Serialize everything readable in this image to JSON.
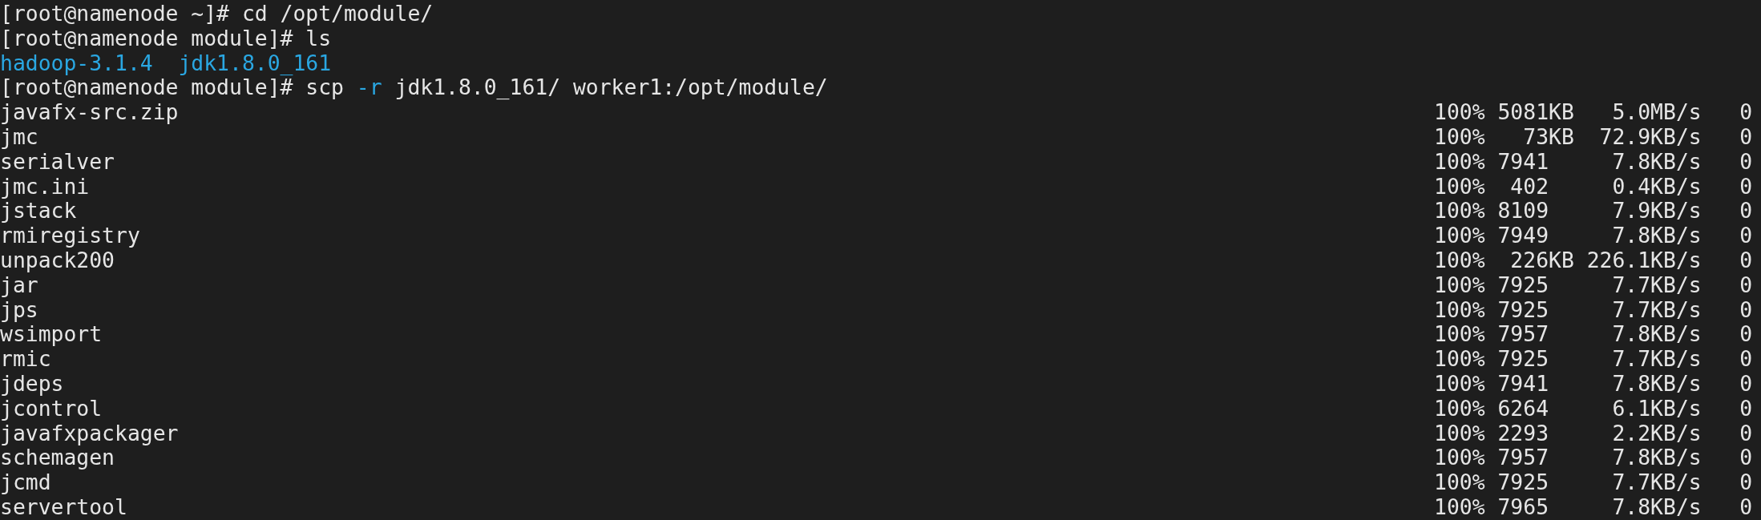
{
  "terminal": {
    "lines": [
      {
        "kind": "prompt",
        "prompt": "[root@namenode ~]#",
        "parts": [
          {
            "text": "cd /opt/module/",
            "kind": "plain"
          }
        ]
      },
      {
        "kind": "prompt",
        "prompt": "[root@namenode module]#",
        "parts": [
          {
            "text": "ls",
            "kind": "plain"
          }
        ]
      },
      {
        "kind": "listing",
        "entries": [
          "hadoop-3.1.4",
          "jdk1.8.0_161"
        ]
      },
      {
        "kind": "prompt",
        "prompt": "[root@namenode module]#",
        "parts": [
          {
            "text": "scp",
            "kind": "plain"
          },
          {
            "text": "-r",
            "kind": "flag"
          },
          {
            "text": "jdk1.8.0_161/ worker1:/opt/module/",
            "kind": "plain"
          }
        ]
      },
      {
        "kind": "transfer",
        "file": "javafx-src.zip",
        "percent": "100%",
        "size": "5081KB",
        "rate": "5.0MB/s",
        "time": "0"
      },
      {
        "kind": "transfer",
        "file": "jmc",
        "percent": "100%",
        "size": "  73KB",
        "rate": "72.9KB/s",
        "time": "0"
      },
      {
        "kind": "transfer",
        "file": "serialver",
        "percent": "100%",
        "size": "7941",
        "rate": "7.8KB/s",
        "time": "0"
      },
      {
        "kind": "transfer",
        "file": "jmc.ini",
        "percent": "100%",
        "size": " 402",
        "rate": "0.4KB/s",
        "time": "0"
      },
      {
        "kind": "transfer",
        "file": "jstack",
        "percent": "100%",
        "size": "8109",
        "rate": "7.9KB/s",
        "time": "0"
      },
      {
        "kind": "transfer",
        "file": "rmiregistry",
        "percent": "100%",
        "size": "7949",
        "rate": "7.8KB/s",
        "time": "0"
      },
      {
        "kind": "transfer",
        "file": "unpack200",
        "percent": "100%",
        "size": " 226KB",
        "rate": "226.1KB/s",
        "time": "0"
      },
      {
        "kind": "transfer",
        "file": "jar",
        "percent": "100%",
        "size": "7925",
        "rate": "7.7KB/s",
        "time": "0"
      },
      {
        "kind": "transfer",
        "file": "jps",
        "percent": "100%",
        "size": "7925",
        "rate": "7.7KB/s",
        "time": "0"
      },
      {
        "kind": "transfer",
        "file": "wsimport",
        "percent": "100%",
        "size": "7957",
        "rate": "7.8KB/s",
        "time": "0"
      },
      {
        "kind": "transfer",
        "file": "rmic",
        "percent": "100%",
        "size": "7925",
        "rate": "7.7KB/s",
        "time": "0"
      },
      {
        "kind": "transfer",
        "file": "jdeps",
        "percent": "100%",
        "size": "7941",
        "rate": "7.8KB/s",
        "time": "0"
      },
      {
        "kind": "transfer",
        "file": "jcontrol",
        "percent": "100%",
        "size": "6264",
        "rate": "6.1KB/s",
        "time": "0"
      },
      {
        "kind": "transfer",
        "file": "javafxpackager",
        "percent": "100%",
        "size": "2293",
        "rate": "2.2KB/s",
        "time": "0"
      },
      {
        "kind": "transfer",
        "file": "schemagen",
        "percent": "100%",
        "size": "7957",
        "rate": "7.8KB/s",
        "time": "0"
      },
      {
        "kind": "transfer",
        "file": "jcmd",
        "percent": "100%",
        "size": "7925",
        "rate": "7.7KB/s",
        "time": "0"
      },
      {
        "kind": "transfer",
        "file": "servertool",
        "percent": "100%",
        "size": "7965",
        "rate": "7.8KB/s",
        "time": "0"
      }
    ]
  }
}
